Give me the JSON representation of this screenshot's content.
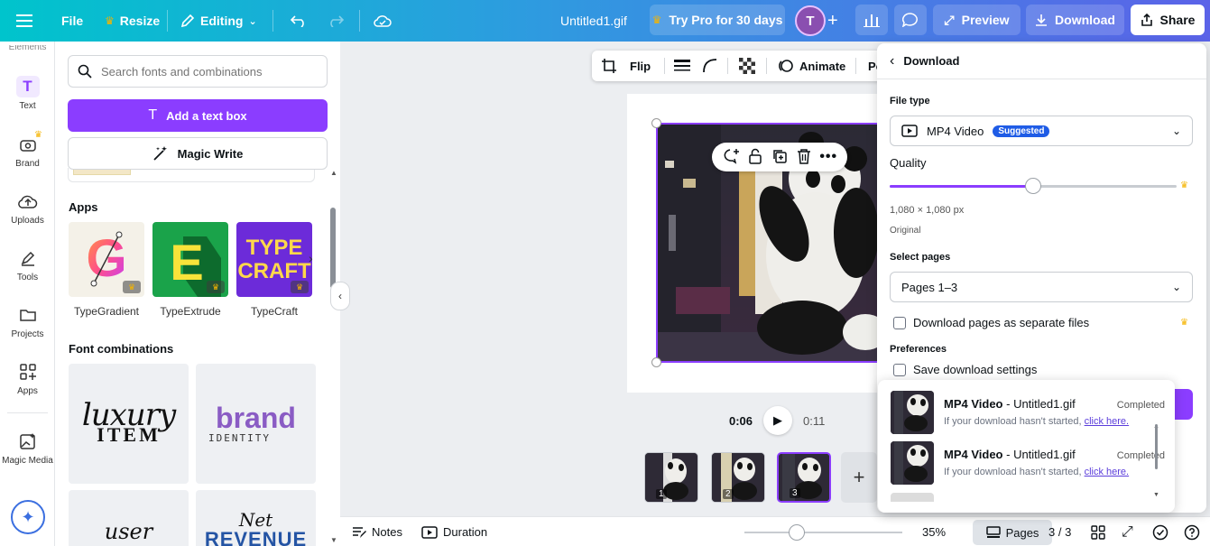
{
  "topbar": {
    "file_label": "File",
    "resize_label": "Resize",
    "editing_label": "Editing",
    "doc_title": "Untitled1.gif",
    "try_pro_label": "Try Pro for 30 days",
    "avatar_initial": "T",
    "preview_label": "Preview",
    "download_label": "Download",
    "share_label": "Share"
  },
  "rail": {
    "clipped_label": "Elements",
    "items": [
      {
        "label": "Text"
      },
      {
        "label": "Brand"
      },
      {
        "label": "Uploads"
      },
      {
        "label": "Tools"
      },
      {
        "label": "Projects"
      },
      {
        "label": "Apps"
      },
      {
        "label": "Magic Media"
      }
    ]
  },
  "panel": {
    "search_placeholder": "Search fonts and combinations",
    "add_text_label": "Add a text box",
    "magic_write_label": "Magic Write",
    "apps_title": "Apps",
    "apps": [
      {
        "label": "TypeGradient",
        "glyph": "G"
      },
      {
        "label": "TypeExtrude",
        "glyph": "E"
      },
      {
        "label": "TypeCraft",
        "glyph1": "TYPE",
        "glyph2": "CRAFT"
      }
    ],
    "font_combinations_title": "Font combinations",
    "combos": [
      {
        "line1": "luxury",
        "line2": "ITEM"
      },
      {
        "line1": "brand",
        "line2": "IDENTITY"
      },
      {
        "line1": "user",
        "line2": ""
      },
      {
        "line1": "Net",
        "line2": "REVENUE"
      }
    ]
  },
  "canvas": {
    "toolbar": {
      "flip_label": "Flip",
      "animate_label": "Animate",
      "position_label": "Po"
    },
    "playback": {
      "current_time": "0:06",
      "total_time": "0:11"
    },
    "thumbs": [
      {
        "num": "1"
      },
      {
        "num": "2"
      },
      {
        "num": "3"
      }
    ],
    "add_page": "+"
  },
  "bottombar": {
    "notes_label": "Notes",
    "duration_label": "Duration",
    "zoom": "35%",
    "pages_label": "Pages",
    "page_count": "3 / 3"
  },
  "download_panel": {
    "title": "Download",
    "file_type_label": "File type",
    "file_type_value": "MP4 Video",
    "suggested_badge": "Suggested",
    "quality_label": "Quality",
    "quality_fraction": 0.5,
    "resolution": "1,080 × 1,080 px",
    "resolution_note": "Original",
    "select_pages_label": "Select pages",
    "pages_value": "Pages 1–3",
    "separate_files_label": "Download pages as separate files",
    "preferences_label": "Preferences",
    "save_settings_label": "Save download settings"
  },
  "downloads": [
    {
      "type": "MP4 Video",
      "file": " - Untitled1.gif",
      "status": "Completed",
      "note": "If your download hasn't started, ",
      "link": "click here."
    },
    {
      "type": "MP4 Video",
      "file": " - Untitled1.gif",
      "status": "Completed",
      "note": "If your download hasn't started, ",
      "link": "click here."
    }
  ],
  "colors": {
    "accent_purple": "#8b3dff",
    "suggested_blue": "#1f5ce6",
    "crown_gold": "#f5b400",
    "topbar_start": "#00c4cc",
    "topbar_end": "#5b63e8"
  }
}
